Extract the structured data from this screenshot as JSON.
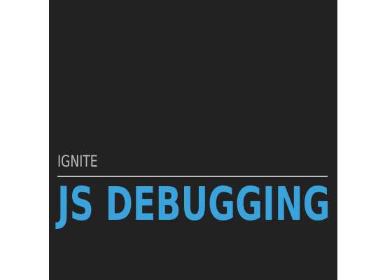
{
  "slide": {
    "subtitle": "IGNITE",
    "title": "JS DEBUGGING"
  },
  "colors": {
    "slide_background": "#222222",
    "subtitle_text": "#bdbdbd",
    "title_accent": "#3aa3db",
    "page_background": "#ffffff"
  }
}
